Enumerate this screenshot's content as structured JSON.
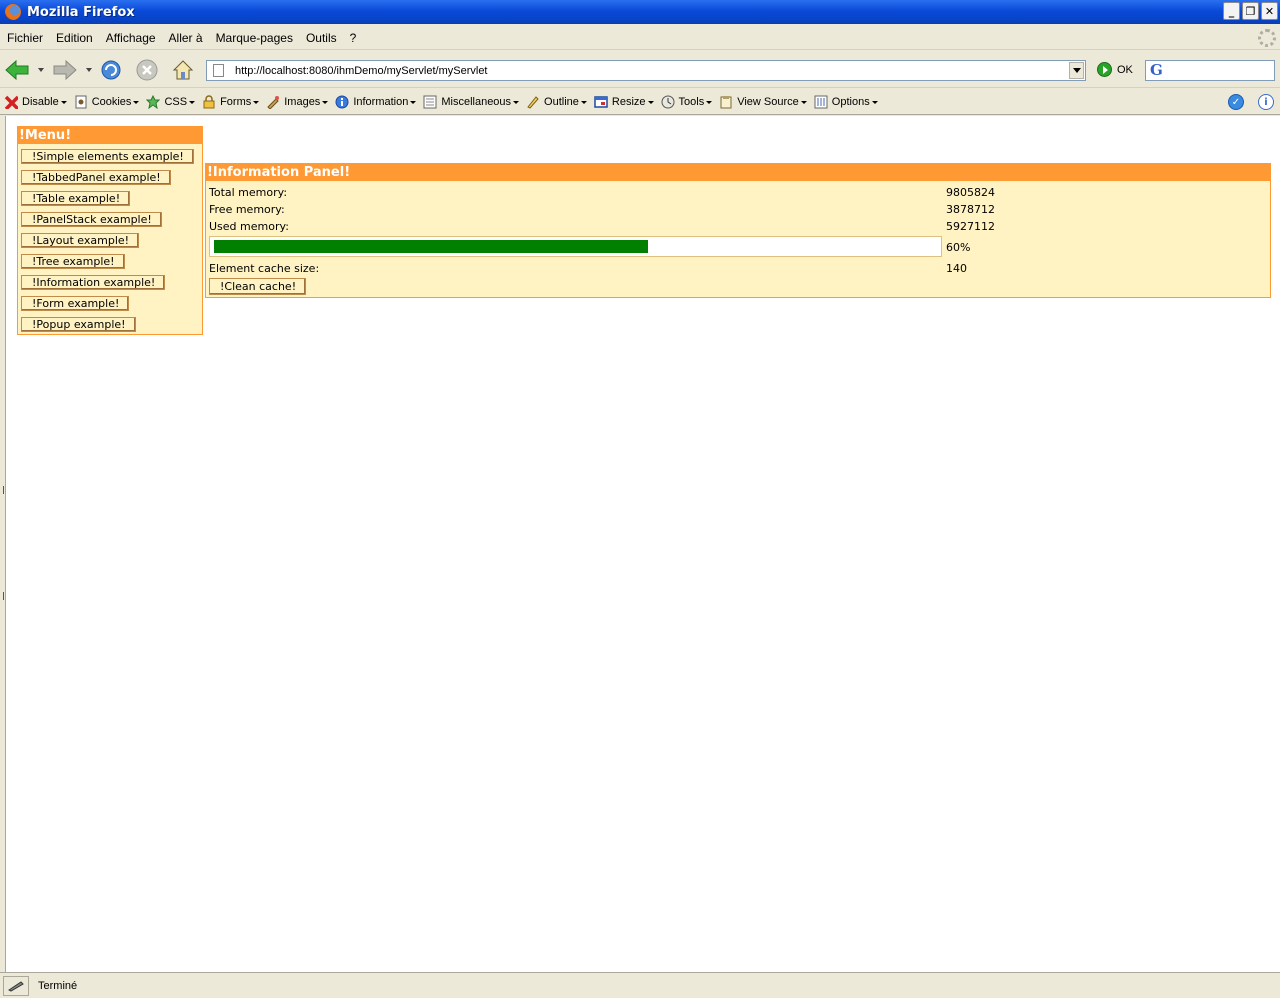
{
  "window": {
    "title": "Mozilla Firefox"
  },
  "menubar": {
    "items": [
      "Fichier",
      "Edition",
      "Affichage",
      "Aller à",
      "Marque-pages",
      "Outils",
      "?"
    ]
  },
  "navbar": {
    "url": "http://localhost:8080/ihmDemo/myServlet/myServlet",
    "go_label": "OK",
    "search_brand": "G"
  },
  "devbar": {
    "items": [
      {
        "label": "Disable",
        "icon": "disable-icon"
      },
      {
        "label": "Cookies",
        "icon": "cookies-icon"
      },
      {
        "label": "CSS",
        "icon": "css-icon"
      },
      {
        "label": "Forms",
        "icon": "forms-icon"
      },
      {
        "label": "Images",
        "icon": "images-icon"
      },
      {
        "label": "Information",
        "icon": "information-icon"
      },
      {
        "label": "Miscellaneous",
        "icon": "miscellaneous-icon"
      },
      {
        "label": "Outline",
        "icon": "outline-icon"
      },
      {
        "label": "Resize",
        "icon": "resize-icon"
      },
      {
        "label": "Tools",
        "icon": "tools-icon"
      },
      {
        "label": "View Source",
        "icon": "view-source-icon"
      },
      {
        "label": "Options",
        "icon": "options-icon"
      }
    ]
  },
  "menu_panel": {
    "title": "!Menu!",
    "buttons": [
      "!Simple elements example!",
      "!TabbedPanel example!",
      "!Table example!",
      "!PanelStack example!",
      "!Layout example!",
      "!Tree example!",
      "!Information example!",
      "!Form example!",
      "!Popup example!"
    ]
  },
  "info_panel": {
    "title": "!Information Panel!",
    "total_label": "Total memory:",
    "total_value": "9805824",
    "free_label": "Free memory:",
    "free_value": "3878712",
    "used_label": "Used memory:",
    "used_value": "5927112",
    "progress_fraction": 0.6,
    "progress_text": "60%",
    "cache_label": "Element cache size:",
    "cache_value": "140",
    "clean_label": "!Clean cache!"
  },
  "status": {
    "text": "Terminé"
  },
  "colors": {
    "panel_header": "#ff9933",
    "panel_bg": "#fff2c3",
    "progress": "#007f00"
  }
}
